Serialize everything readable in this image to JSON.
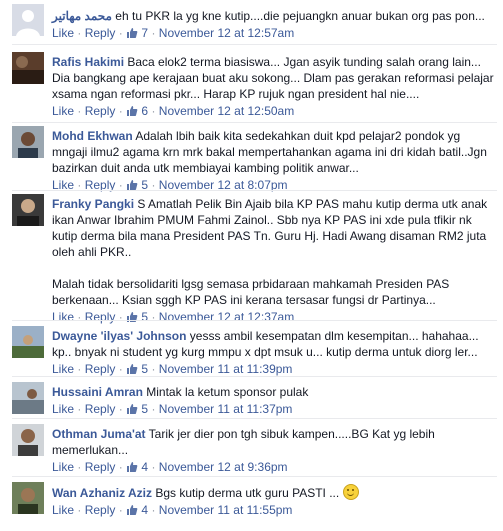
{
  "actions": {
    "like": "Like",
    "reply": "Reply",
    "sep": "·"
  },
  "comments": [
    {
      "name": "محمد مهاتير",
      "text": "eh tu PKR la yg kne kutip....die pejuangkn anuar bukan org pas pon...",
      "likes": "7",
      "time": "November 12 at 12:57am",
      "avatar_icon": "blank-avatar"
    },
    {
      "name": "Rafis Hakimi",
      "text": "Baca elok2 terma biasiswa... Jgan asyik tunding salah orang lain... Dia bangkang ape kerajaan buat aku sokong... Dlam pas gerakan reformasi pelajar xsama ngan reformasi pkr... Harap KP rujuk ngan president hal nie....",
      "likes": "6",
      "time": "November 12 at 12:50am",
      "avatar_icon": "photo-avatar"
    },
    {
      "name": "Mohd Ekhwan",
      "text": "Adalah lbih baik kita sedekahkan duit kpd pelajar2 pondok yg mngaji ilmu2 agama krn mrk bakal mempertahankan agama ini dri kidah batil..Jgn bazirkan duit anda utk membiayai kambing politik anwar...",
      "likes": "5",
      "time": "November 12 at 8:07pm",
      "avatar_icon": "photo-avatar"
    },
    {
      "name": "Franky Pangki",
      "text": "S Amatlah Pelik Bin Ajaib bila KP PAS mahu kutip derma utk anak ikan Anwar Ibrahim PMUM Fahmi Zainol.. Sbb nya KP PAS ini xde pula tfikir nk kutip derma bila mana President PAS Tn. Guru Hj. Hadi Awang disaman RM2 juta oleh ahli PKR..",
      "text2": "Malah tidak bersolidariti lgsg semasa prbidaraan mahkamah Presiden PAS berkenaan... Ksian sggh KP PAS ini kerana tersasar fungsi dr Partinya...",
      "likes": "5",
      "time": "November 12 at 12:37am",
      "avatar_icon": "photo-avatar"
    },
    {
      "name": "Dwayne 'ilyas' Johnson",
      "text": "yesss ambil kesempatan dlm kesempitan... hahahaa... kp.. bnyak ni student yg kurg mmpu x dpt msuk u... kutip derma untuk diorg ler...",
      "likes": "5",
      "time": "November 11 at 11:39pm",
      "avatar_icon": "photo-avatar"
    },
    {
      "name": "Hussaini Amran",
      "text": "Mintak la ketum sponsor pulak",
      "likes": "5",
      "time": "November 11 at 11:37pm",
      "avatar_icon": "photo-avatar"
    },
    {
      "name": "Othman Juma'at",
      "text": "Tarik jer dier pon tgh sibuk kampen.....BG Kat yg lebih memerlukan...",
      "likes": "4",
      "time": "November 12 at 9:36pm",
      "avatar_icon": "photo-avatar"
    },
    {
      "name": "Wan Azhaniz Aziz",
      "text": "Bgs kutip derma utk guru PASTI ...",
      "likes": "4",
      "time": "November 11 at 11:55pm",
      "avatar_icon": "photo-avatar"
    }
  ]
}
